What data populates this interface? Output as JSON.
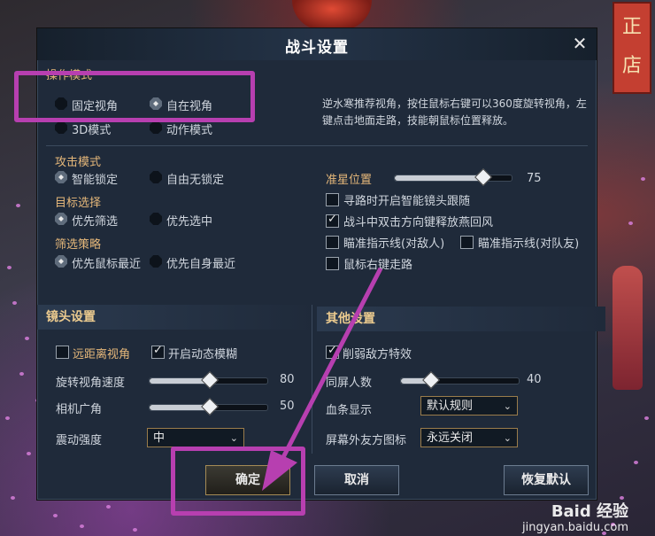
{
  "dialog": {
    "title": "战斗设置"
  },
  "operation_mode": {
    "header": "操作模式",
    "options": [
      {
        "label": "固定视角",
        "selected": false
      },
      {
        "label": "自在视角",
        "selected": true
      },
      {
        "label": "3D模式",
        "selected": false
      },
      {
        "label": "动作模式",
        "selected": false
      }
    ],
    "hint": "逆水寒推荐视角，按住鼠标右键可以360度旋转视角，左键点击地面走路，技能朝鼠标位置释放。"
  },
  "attack_mode": {
    "header": "攻击模式",
    "options": [
      {
        "label": "智能锁定",
        "selected": true
      },
      {
        "label": "自由无锁定",
        "selected": false
      }
    ]
  },
  "target_select": {
    "header": "目标选择",
    "options": [
      {
        "label": "优先筛选",
        "selected": true
      },
      {
        "label": "优先选中",
        "selected": false
      }
    ]
  },
  "filter_strategy": {
    "header": "筛选策略",
    "options": [
      {
        "label": "优先鼠标最近",
        "selected": true
      },
      {
        "label": "优先自身最近",
        "selected": false
      }
    ]
  },
  "aim": {
    "label": "准星位置",
    "value": "75",
    "level": 0.75,
    "checks": [
      {
        "label": "寻路时开启智能镜头跟随",
        "checked": false
      },
      {
        "label": "战斗中双击方向键释放燕回风",
        "checked": true
      },
      {
        "label": "瞄准指示线(对敌人)",
        "checked": false
      },
      {
        "label": "瞄准指示线(对队友)",
        "checked": false
      },
      {
        "label": "鼠标右键走路",
        "checked": false
      }
    ]
  },
  "camera": {
    "header": "镜头设置",
    "far_view": {
      "label": "远距离视角",
      "checked": false
    },
    "motion_blur": {
      "label": "开启动态模糊",
      "checked": true
    },
    "rotate_speed": {
      "label": "旋转视角速度",
      "value": "80",
      "level": 0.5
    },
    "fov": {
      "label": "相机广角",
      "value": "50",
      "level": 0.5
    },
    "shake": {
      "label": "震动强度",
      "selected": "中"
    }
  },
  "other": {
    "header": "其他设置",
    "weaken_fx": {
      "label": "削弱敌方特效",
      "checked": true
    },
    "same_screen": {
      "label": "同屏人数",
      "value": "40",
      "level": 0.25
    },
    "hp_bar": {
      "label": "血条显示",
      "selected": "默认规则"
    },
    "offscreen_icon": {
      "label": "屏幕外友方图标",
      "selected": "永远关闭"
    }
  },
  "buttons": {
    "confirm": "确定",
    "cancel": "取消",
    "reset": "恢复默认"
  },
  "background": {
    "shop_sign": [
      "正",
      "店"
    ]
  },
  "watermark": {
    "brand": "Baid 经验",
    "url": "jingyan.baidu.com"
  },
  "colors": {
    "highlight": "#b73fb0",
    "dialog_bg": "#1f2a3a",
    "section_header": "#eccb8f"
  }
}
